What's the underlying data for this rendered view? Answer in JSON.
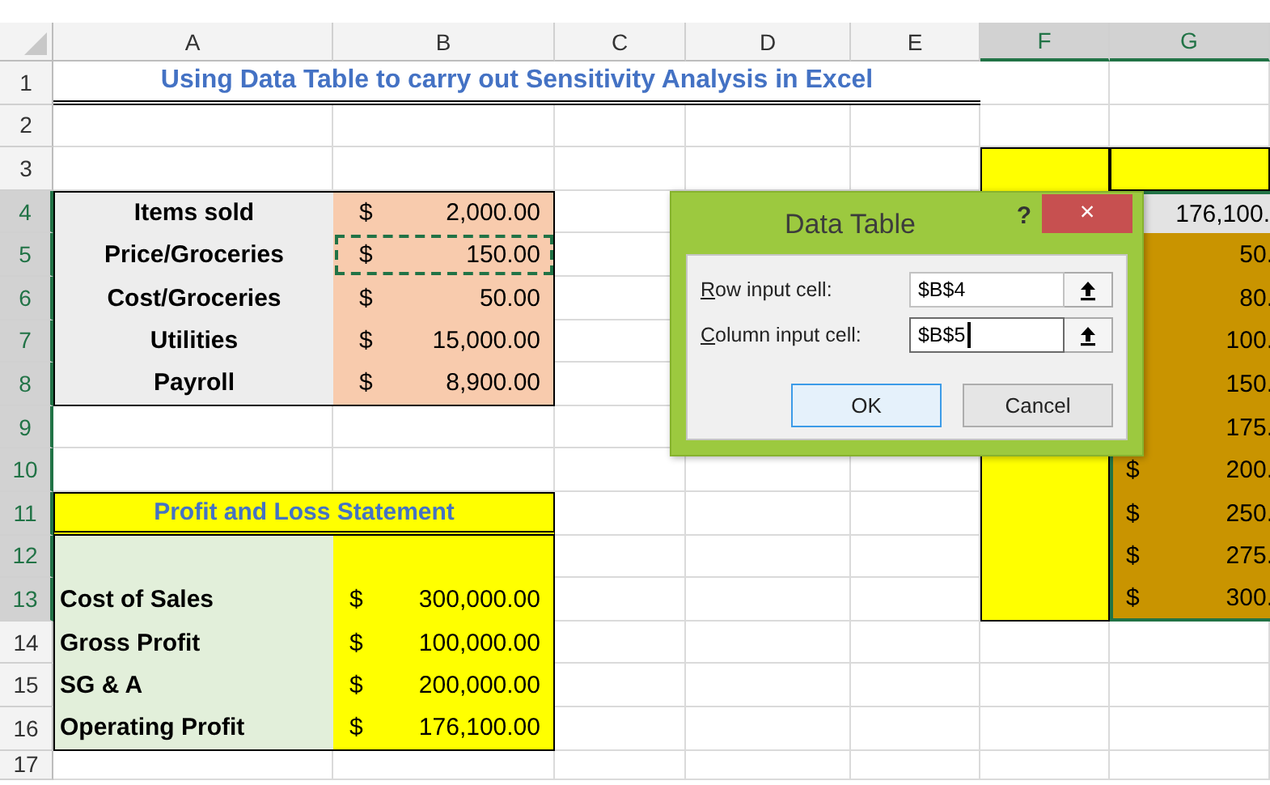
{
  "column_headers": [
    {
      "label": "A",
      "selected": false
    },
    {
      "label": "B",
      "selected": false
    },
    {
      "label": "C",
      "selected": false
    },
    {
      "label": "D",
      "selected": false
    },
    {
      "label": "E",
      "selected": false
    },
    {
      "label": "F",
      "selected": true
    },
    {
      "label": "G",
      "selected": true
    }
  ],
  "row_headers": [
    {
      "label": "1",
      "selected": false
    },
    {
      "label": "2",
      "selected": false
    },
    {
      "label": "3",
      "selected": false
    },
    {
      "label": "4",
      "selected": true
    },
    {
      "label": "5",
      "selected": true
    },
    {
      "label": "6",
      "selected": true
    },
    {
      "label": "7",
      "selected": true
    },
    {
      "label": "8",
      "selected": true
    },
    {
      "label": "9",
      "selected": true
    },
    {
      "label": "10",
      "selected": true
    },
    {
      "label": "11",
      "selected": true
    },
    {
      "label": "12",
      "selected": true
    },
    {
      "label": "13",
      "selected": true
    },
    {
      "label": "14",
      "selected": false
    },
    {
      "label": "15",
      "selected": false
    },
    {
      "label": "16",
      "selected": false
    },
    {
      "label": "17",
      "selected": false
    }
  ],
  "title": "Using Data Table to carry out Sensitivity Analysis in Excel",
  "inputs": [
    {
      "label": "Items sold",
      "currency": "$",
      "value": "2,000.00",
      "copied": false
    },
    {
      "label": "Price/Groceries",
      "currency": "$",
      "value": "150.00",
      "copied": true
    },
    {
      "label": "Cost/Groceries",
      "currency": "$",
      "value": "50.00",
      "copied": false
    },
    {
      "label": "Utilities",
      "currency": "$",
      "value": "15,000.00",
      "copied": false
    },
    {
      "label": "Payroll",
      "currency": "$",
      "value": "8,900.00",
      "copied": false
    }
  ],
  "pnl": {
    "heading": "Profit and Loss Statement",
    "rows": [
      {
        "label": "Cost of Sales",
        "currency": "$",
        "value": "300,000.00"
      },
      {
        "label": "Gross Profit",
        "currency": "$",
        "value": "100,000.00"
      },
      {
        "label": "SG & A",
        "currency": "$",
        "value": "200,000.00"
      },
      {
        "label": "Operating Profit",
        "currency": "$",
        "value": "176,100.00"
      }
    ]
  },
  "data_table": {
    "formula_value": "176,100.",
    "rows": [
      {
        "value": "50."
      },
      {
        "value": "80."
      },
      {
        "value": "100."
      },
      {
        "value": "150."
      },
      {
        "value": "175."
      },
      {
        "currency": "$",
        "value": "200."
      },
      {
        "currency": "$",
        "value": "250."
      },
      {
        "currency": "$",
        "value": "275."
      },
      {
        "currency": "$",
        "value": "300."
      }
    ]
  },
  "dialog": {
    "title": "Data Table",
    "help": "?",
    "close": "×",
    "fields": [
      {
        "label": "Row input cell:",
        "value": "$B$4",
        "focused": false
      },
      {
        "label": "Column input cell:",
        "value": "$B$5",
        "focused": true
      }
    ],
    "buttons": [
      {
        "label": "OK",
        "default": true
      },
      {
        "label": "Cancel",
        "default": false
      }
    ]
  }
}
